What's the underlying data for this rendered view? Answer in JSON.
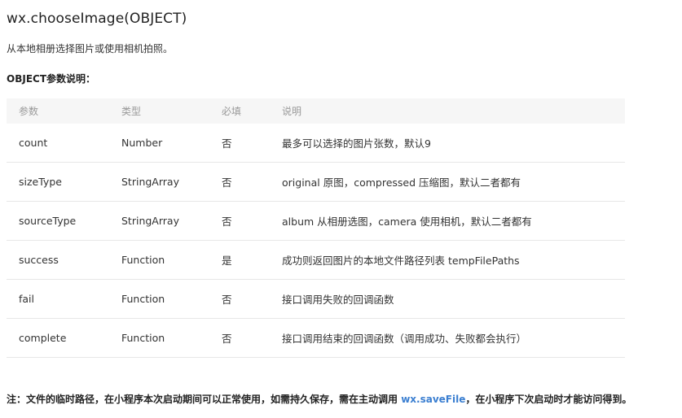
{
  "title": "wx.chooseImage(OBJECT)",
  "description": "从本地相册选择图片或使用相机拍照。",
  "param_heading": "OBJECT参数说明：",
  "table": {
    "headers": [
      "参数",
      "类型",
      "必填",
      "说明"
    ],
    "rows": [
      [
        "count",
        "Number",
        "否",
        "最多可以选择的图片张数，默认9"
      ],
      [
        "sizeType",
        "StringArray",
        "否",
        "original 原图，compressed 压缩图，默认二者都有"
      ],
      [
        "sourceType",
        "StringArray",
        "否",
        "album 从相册选图，camera 使用相机，默认二者都有"
      ],
      [
        "success",
        "Function",
        "是",
        "成功则返回图片的本地文件路径列表 tempFilePaths"
      ],
      [
        "fail",
        "Function",
        "否",
        "接口调用失败的回调函数"
      ],
      [
        "complete",
        "Function",
        "否",
        "接口调用结束的回调函数（调用成功、失败都会执行）"
      ]
    ]
  },
  "note": {
    "prefix": "注：文件的临时路径，在小程序本次启动期间可以正常使用，如需持久保存，需在主动调用 ",
    "link": "wx.saveFile",
    "suffix": "，在小程序下次启动时才能访问得到。"
  },
  "colors": {
    "link": "#3b7fd1",
    "header_bg": "#f6f6f6",
    "header_text": "#999999",
    "row_border": "#e7e7e7"
  }
}
